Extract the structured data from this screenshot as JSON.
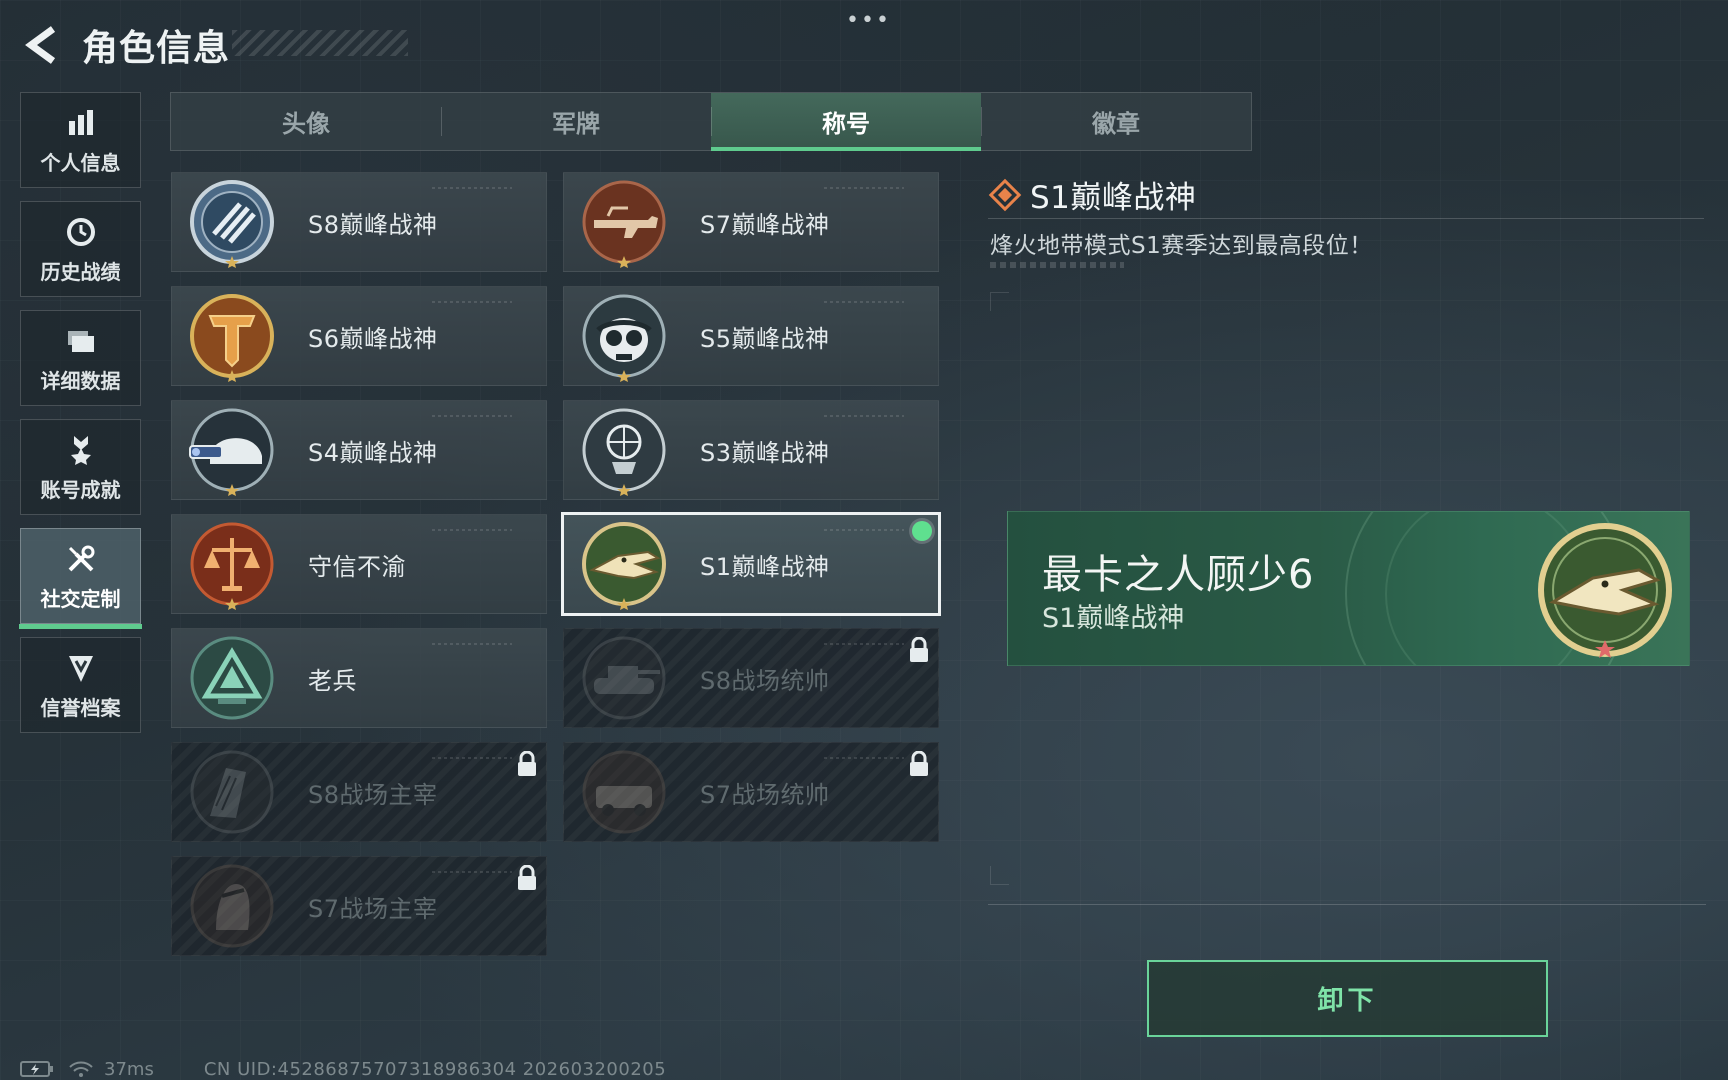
{
  "header": {
    "title": "角色信息",
    "more": "•••"
  },
  "nav": {
    "items": [
      {
        "label": "个人信息",
        "icon": "bar-chart-icon"
      },
      {
        "label": "历史战绩",
        "icon": "history-icon"
      },
      {
        "label": "详细数据",
        "icon": "folder-icon"
      },
      {
        "label": "账号成就",
        "icon": "achievement-icon"
      },
      {
        "label": "社交定制",
        "icon": "tools-icon",
        "active": true
      },
      {
        "label": "信誉档案",
        "icon": "shield-v-icon"
      }
    ]
  },
  "tabs": [
    {
      "label": "头像"
    },
    {
      "label": "军牌"
    },
    {
      "label": "称号",
      "active": true
    },
    {
      "label": "徽章"
    }
  ],
  "titles": [
    {
      "label": "S8巅峰战神",
      "locked": false
    },
    {
      "label": "S7巅峰战神",
      "locked": false
    },
    {
      "label": "S6巅峰战神",
      "locked": false
    },
    {
      "label": "S5巅峰战神",
      "locked": false
    },
    {
      "label": "S4巅峰战神",
      "locked": false
    },
    {
      "label": "S3巅峰战神",
      "locked": false
    },
    {
      "label": "守信不渝",
      "locked": false
    },
    {
      "label": "S1巅峰战神",
      "locked": false,
      "selected": true,
      "equipped": true
    },
    {
      "label": "老兵",
      "locked": false
    },
    {
      "label": "S8战场统帅",
      "locked": true
    },
    {
      "label": "S8战场主宰",
      "locked": true
    },
    {
      "label": "S7战场统帅",
      "locked": true
    },
    {
      "label": "S7战场主宰",
      "locked": true
    }
  ],
  "detail": {
    "title": "S1巅峰战神",
    "description": "烽火地带模式S1赛季达到最高段位！",
    "banner": {
      "player_name": "最卡之人顾少6",
      "title": "S1巅峰战神"
    },
    "action_label": "卸下"
  },
  "status": {
    "ping": "37ms",
    "uid": "CN UID:4528687570731898630‌4 202603200205"
  },
  "colors": {
    "accent": "#5fcb8e",
    "equipped": "#5fe08f",
    "banner_bg": "#2a5a46",
    "medal_gold": "#d9b25a"
  }
}
